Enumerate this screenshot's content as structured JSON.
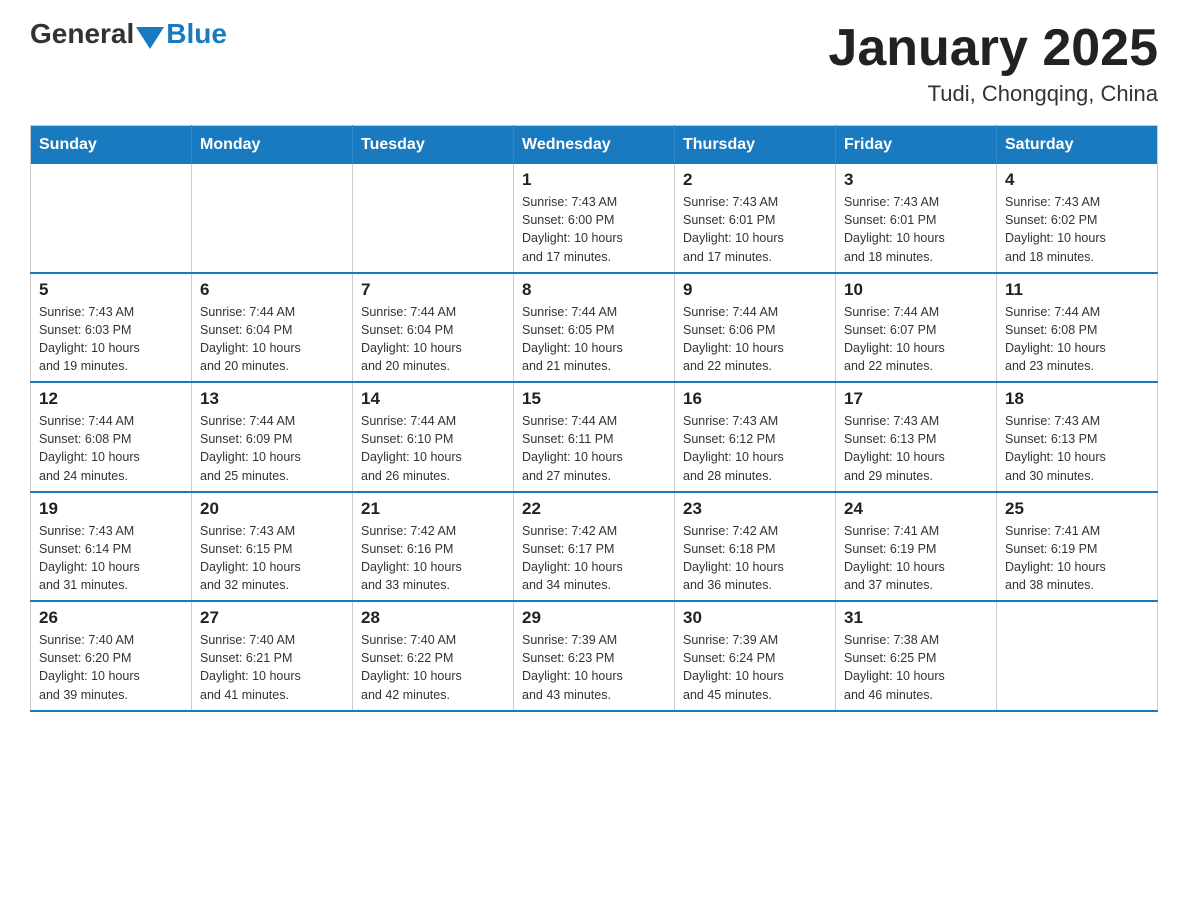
{
  "logo": {
    "text_general": "General",
    "text_blue": "Blue"
  },
  "calendar": {
    "title": "January 2025",
    "subtitle": "Tudi, Chongqing, China",
    "days_of_week": [
      "Sunday",
      "Monday",
      "Tuesday",
      "Wednesday",
      "Thursday",
      "Friday",
      "Saturday"
    ],
    "weeks": [
      [
        {
          "day": "",
          "info": ""
        },
        {
          "day": "",
          "info": ""
        },
        {
          "day": "",
          "info": ""
        },
        {
          "day": "1",
          "info": "Sunrise: 7:43 AM\nSunset: 6:00 PM\nDaylight: 10 hours\nand 17 minutes."
        },
        {
          "day": "2",
          "info": "Sunrise: 7:43 AM\nSunset: 6:01 PM\nDaylight: 10 hours\nand 17 minutes."
        },
        {
          "day": "3",
          "info": "Sunrise: 7:43 AM\nSunset: 6:01 PM\nDaylight: 10 hours\nand 18 minutes."
        },
        {
          "day": "4",
          "info": "Sunrise: 7:43 AM\nSunset: 6:02 PM\nDaylight: 10 hours\nand 18 minutes."
        }
      ],
      [
        {
          "day": "5",
          "info": "Sunrise: 7:43 AM\nSunset: 6:03 PM\nDaylight: 10 hours\nand 19 minutes."
        },
        {
          "day": "6",
          "info": "Sunrise: 7:44 AM\nSunset: 6:04 PM\nDaylight: 10 hours\nand 20 minutes."
        },
        {
          "day": "7",
          "info": "Sunrise: 7:44 AM\nSunset: 6:04 PM\nDaylight: 10 hours\nand 20 minutes."
        },
        {
          "day": "8",
          "info": "Sunrise: 7:44 AM\nSunset: 6:05 PM\nDaylight: 10 hours\nand 21 minutes."
        },
        {
          "day": "9",
          "info": "Sunrise: 7:44 AM\nSunset: 6:06 PM\nDaylight: 10 hours\nand 22 minutes."
        },
        {
          "day": "10",
          "info": "Sunrise: 7:44 AM\nSunset: 6:07 PM\nDaylight: 10 hours\nand 22 minutes."
        },
        {
          "day": "11",
          "info": "Sunrise: 7:44 AM\nSunset: 6:08 PM\nDaylight: 10 hours\nand 23 minutes."
        }
      ],
      [
        {
          "day": "12",
          "info": "Sunrise: 7:44 AM\nSunset: 6:08 PM\nDaylight: 10 hours\nand 24 minutes."
        },
        {
          "day": "13",
          "info": "Sunrise: 7:44 AM\nSunset: 6:09 PM\nDaylight: 10 hours\nand 25 minutes."
        },
        {
          "day": "14",
          "info": "Sunrise: 7:44 AM\nSunset: 6:10 PM\nDaylight: 10 hours\nand 26 minutes."
        },
        {
          "day": "15",
          "info": "Sunrise: 7:44 AM\nSunset: 6:11 PM\nDaylight: 10 hours\nand 27 minutes."
        },
        {
          "day": "16",
          "info": "Sunrise: 7:43 AM\nSunset: 6:12 PM\nDaylight: 10 hours\nand 28 minutes."
        },
        {
          "day": "17",
          "info": "Sunrise: 7:43 AM\nSunset: 6:13 PM\nDaylight: 10 hours\nand 29 minutes."
        },
        {
          "day": "18",
          "info": "Sunrise: 7:43 AM\nSunset: 6:13 PM\nDaylight: 10 hours\nand 30 minutes."
        }
      ],
      [
        {
          "day": "19",
          "info": "Sunrise: 7:43 AM\nSunset: 6:14 PM\nDaylight: 10 hours\nand 31 minutes."
        },
        {
          "day": "20",
          "info": "Sunrise: 7:43 AM\nSunset: 6:15 PM\nDaylight: 10 hours\nand 32 minutes."
        },
        {
          "day": "21",
          "info": "Sunrise: 7:42 AM\nSunset: 6:16 PM\nDaylight: 10 hours\nand 33 minutes."
        },
        {
          "day": "22",
          "info": "Sunrise: 7:42 AM\nSunset: 6:17 PM\nDaylight: 10 hours\nand 34 minutes."
        },
        {
          "day": "23",
          "info": "Sunrise: 7:42 AM\nSunset: 6:18 PM\nDaylight: 10 hours\nand 36 minutes."
        },
        {
          "day": "24",
          "info": "Sunrise: 7:41 AM\nSunset: 6:19 PM\nDaylight: 10 hours\nand 37 minutes."
        },
        {
          "day": "25",
          "info": "Sunrise: 7:41 AM\nSunset: 6:19 PM\nDaylight: 10 hours\nand 38 minutes."
        }
      ],
      [
        {
          "day": "26",
          "info": "Sunrise: 7:40 AM\nSunset: 6:20 PM\nDaylight: 10 hours\nand 39 minutes."
        },
        {
          "day": "27",
          "info": "Sunrise: 7:40 AM\nSunset: 6:21 PM\nDaylight: 10 hours\nand 41 minutes."
        },
        {
          "day": "28",
          "info": "Sunrise: 7:40 AM\nSunset: 6:22 PM\nDaylight: 10 hours\nand 42 minutes."
        },
        {
          "day": "29",
          "info": "Sunrise: 7:39 AM\nSunset: 6:23 PM\nDaylight: 10 hours\nand 43 minutes."
        },
        {
          "day": "30",
          "info": "Sunrise: 7:39 AM\nSunset: 6:24 PM\nDaylight: 10 hours\nand 45 minutes."
        },
        {
          "day": "31",
          "info": "Sunrise: 7:38 AM\nSunset: 6:25 PM\nDaylight: 10 hours\nand 46 minutes."
        },
        {
          "day": "",
          "info": ""
        }
      ]
    ]
  }
}
